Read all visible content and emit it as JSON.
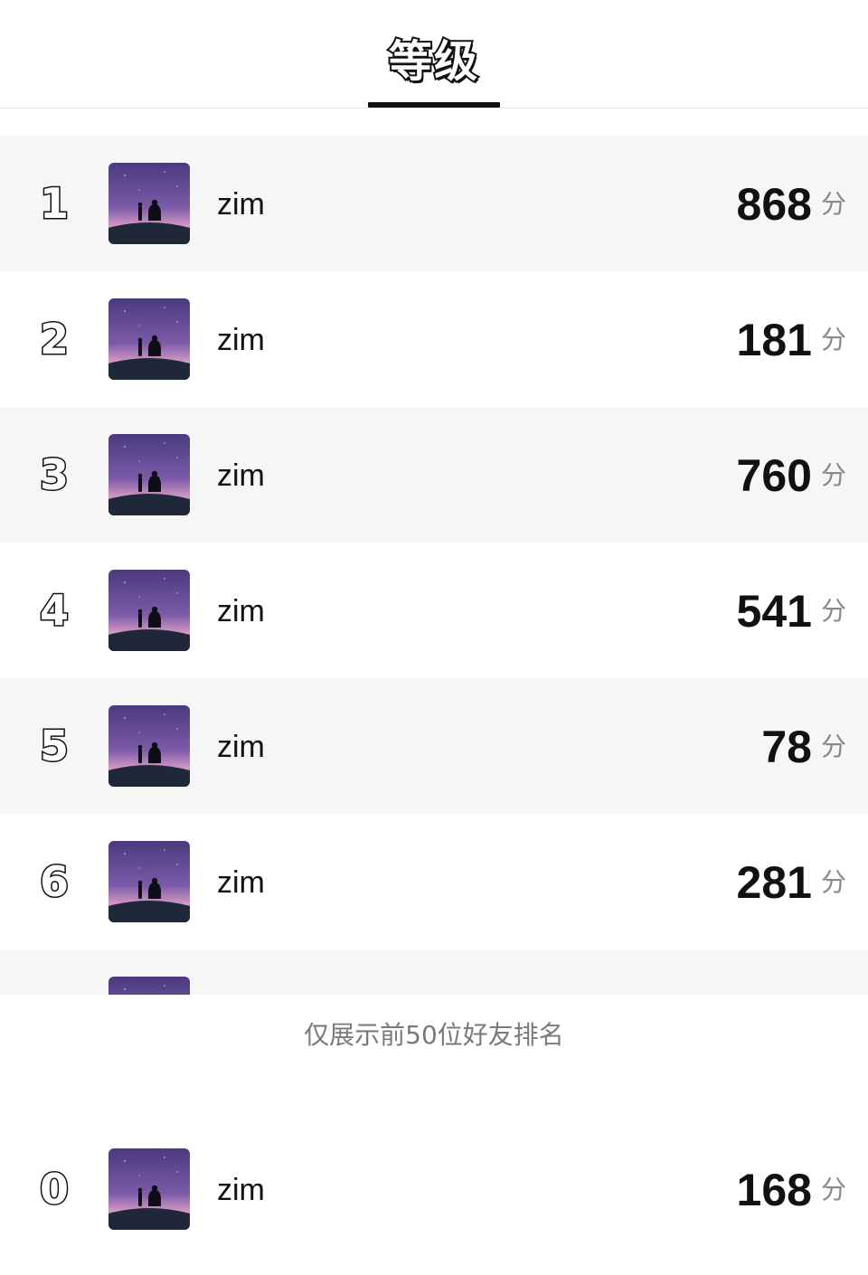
{
  "header": {
    "tab_title": "等级"
  },
  "ranking": {
    "unit": "分",
    "rows": [
      {
        "rank": "1",
        "name": "zim",
        "score": "868"
      },
      {
        "rank": "2",
        "name": "zim",
        "score": "181"
      },
      {
        "rank": "3",
        "name": "zim",
        "score": "760"
      },
      {
        "rank": "4",
        "name": "zim",
        "score": "541"
      },
      {
        "rank": "5",
        "name": "zim",
        "score": "78"
      },
      {
        "rank": "6",
        "name": "zim",
        "score": "281"
      }
    ]
  },
  "footer": {
    "note": "仅展示前50位好友排名"
  },
  "my_rank": {
    "rank": "0",
    "name": "zim",
    "score": "168",
    "unit": "分"
  },
  "colors": {
    "row_alt_bg": "#f6f6f6",
    "text": "#111111",
    "muted": "#888888"
  }
}
